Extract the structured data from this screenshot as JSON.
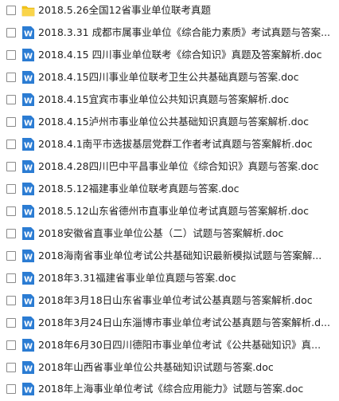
{
  "colors": {
    "word_icon": "#2b7cd3",
    "folder_icon": "#f5c518"
  },
  "files": [
    {
      "type": "folder",
      "icon": "folder-icon",
      "name": "2018.5.26全国12省事业单位联考真题"
    },
    {
      "type": "word",
      "icon": "word-doc-icon",
      "name": "2018.3.31 成都市属事业单位《综合能力素质》考试真题与答案..."
    },
    {
      "type": "word",
      "icon": "word-doc-icon",
      "name": "2018.4.15 四川事业单位联考《综合知识》真题及答案解析.doc"
    },
    {
      "type": "word",
      "icon": "word-doc-icon",
      "name": "2018.4.15四川事业单位联考卫生公共基础真题与答案.doc"
    },
    {
      "type": "word",
      "icon": "word-doc-icon",
      "name": "2018.4.15宜宾市事业单位公共知识真题与答案解析.doc"
    },
    {
      "type": "word",
      "icon": "word-doc-icon",
      "name": "2018.4.15泸州市事业单位公共基础知识真题与答案解析.doc"
    },
    {
      "type": "word",
      "icon": "word-doc-icon",
      "name": "2018.4.1南平市选拔基层党群工作者考试真题与答案解析.doc"
    },
    {
      "type": "word",
      "icon": "word-doc-icon",
      "name": "2018.4.28四川巴中平昌事业单位《综合知识》真题与答案.doc"
    },
    {
      "type": "word",
      "icon": "word-doc-icon",
      "name": "2018.5.12福建事业单位联考真题与答案.doc"
    },
    {
      "type": "word",
      "icon": "word-doc-icon",
      "name": "2018.5.12山东省德州市直事业单位考试真题与答案解析.doc"
    },
    {
      "type": "word",
      "icon": "word-doc-icon",
      "name": "2018安徽省直事业单位公基（二）试题与答案解析.doc"
    },
    {
      "type": "word",
      "icon": "word-doc-icon",
      "name": "2018海南省事业单位考试公共基础知识最新模拟试题与答案解..."
    },
    {
      "type": "word",
      "icon": "word-doc-icon",
      "name": "2018年3.31福建省事业单位真题与答案.doc"
    },
    {
      "type": "word",
      "icon": "word-doc-icon",
      "name": "2018年3月18日山东省事业单位考试公基真题与答案解析.doc"
    },
    {
      "type": "word",
      "icon": "word-doc-icon",
      "name": "2018年3月24日山东淄博市事业单位考试公基真题与答案解析.d..."
    },
    {
      "type": "word",
      "icon": "word-doc-icon",
      "name": "2018年6月30日四川德阳市事业单位考试《公共基础知识》真..."
    },
    {
      "type": "word",
      "icon": "word-doc-icon",
      "name": "2018年山西省事业单位公共基础知识试题与答案.doc"
    },
    {
      "type": "word",
      "icon": "word-doc-icon",
      "name": "2018年上海事业单位考试《综合应用能力》试题与答案.doc"
    }
  ]
}
